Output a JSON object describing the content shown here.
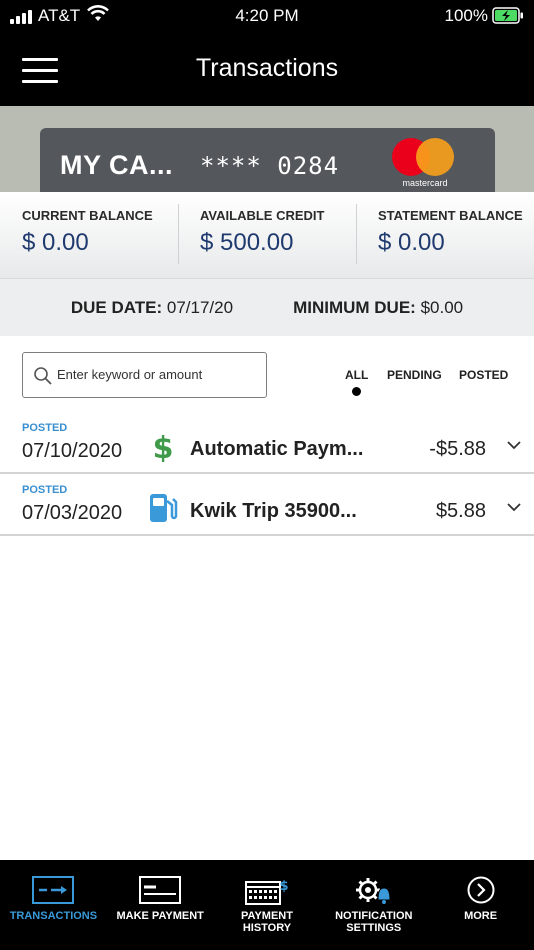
{
  "status_bar": {
    "carrier": "AT&T",
    "time": "4:20 PM",
    "battery": "100%",
    "icons": [
      "signal-icon",
      "wifi-icon",
      "battery-charging-icon"
    ]
  },
  "nav": {
    "title": "Transactions",
    "menu_icon": "hamburger-menu-icon"
  },
  "card": {
    "name": "MY CA...",
    "number": "**** 0284",
    "brand": "mastercard"
  },
  "balances": [
    {
      "label": "CURRENT BALANCE",
      "value": "$ 0.00"
    },
    {
      "label": "AVAILABLE CREDIT",
      "value": "$ 500.00"
    },
    {
      "label": "STATEMENT BALANCE",
      "value": "$ 0.00"
    }
  ],
  "due": {
    "due_date_label": "DUE DATE:",
    "due_date": "07/17/20",
    "minimum_due_label": "MINIMUM DUE:",
    "minimum_due": "$0.00"
  },
  "search": {
    "placeholder": "Enter keyword or amount"
  },
  "filters": {
    "items": [
      "ALL",
      "PENDING",
      "POSTED"
    ],
    "selected": "ALL"
  },
  "transactions": [
    {
      "status": "POSTED",
      "date": "07/10/2020",
      "icon": "dollar-icon",
      "description": "Automatic Paym...",
      "amount": "-$5.88"
    },
    {
      "status": "POSTED",
      "date": "07/03/2020",
      "icon": "gas-pump-icon",
      "description": "Kwik Trip 35900...",
      "amount": "$5.88"
    }
  ],
  "tab_bar": {
    "active": "TRANSACTIONS",
    "items": [
      {
        "label": "TRANSACTIONS",
        "icon": "transactions-icon"
      },
      {
        "label": "MAKE PAYMENT",
        "icon": "make-payment-icon"
      },
      {
        "label": "PAYMENT HISTORY",
        "icon": "payment-history-icon"
      },
      {
        "label": "NOTIFICATION SETTINGS",
        "icon": "notification-settings-icon"
      },
      {
        "label": "MORE",
        "icon": "chevron-right-circle-icon"
      }
    ]
  },
  "colors": {
    "accent": "#3a9ad9",
    "balance_value": "#1f3a6e",
    "posted": "#3a8fd0",
    "dollar_icon": "#3f9a4a",
    "gas_icon": "#3a9ad9"
  }
}
